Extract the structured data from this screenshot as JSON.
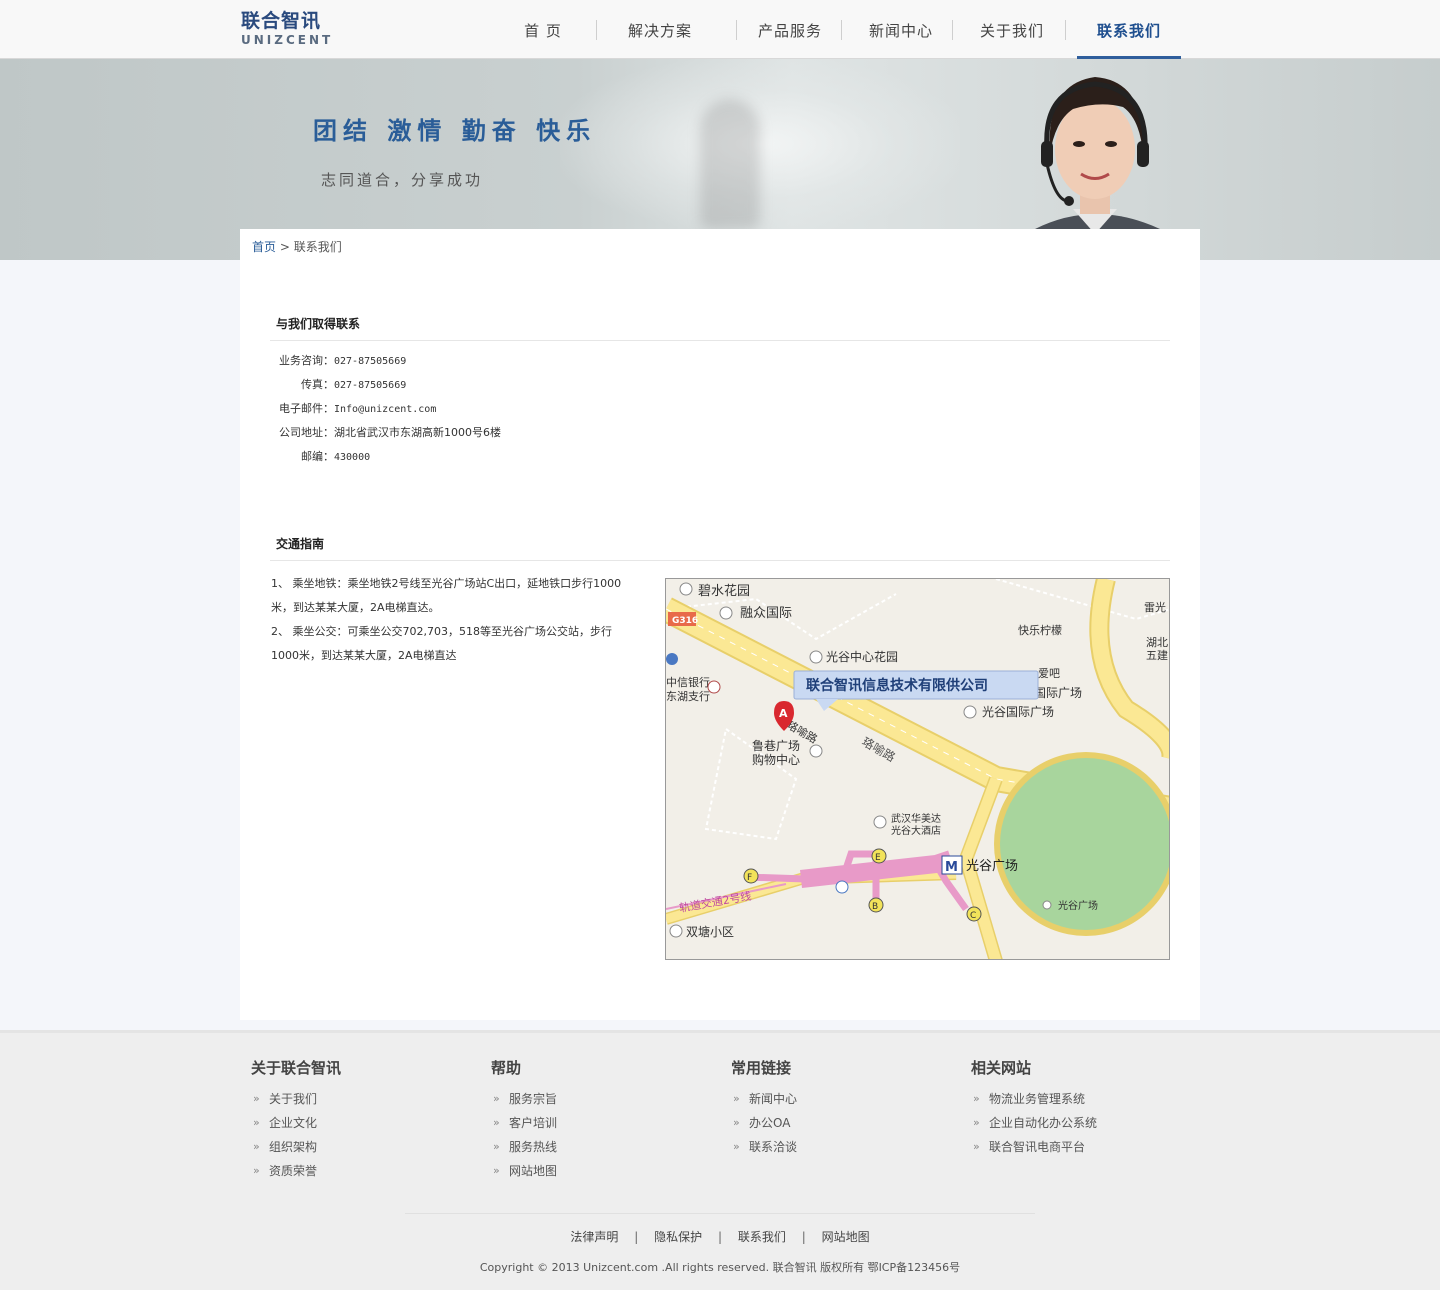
{
  "header": {
    "logo_cn": "联合智讯",
    "logo_en": "UNIZCENT",
    "nav": [
      {
        "label": "首 页"
      },
      {
        "label": "解决方案"
      },
      {
        "label": "产品服务"
      },
      {
        "label": "新闻中心"
      },
      {
        "label": "关于我们"
      },
      {
        "label": "联系我们"
      }
    ],
    "active_color": "#1f4f8f"
  },
  "banner": {
    "slogan": "团结 激情 勤奋 快乐",
    "subslogan": "志同道合，分享成功"
  },
  "breadcrumb": {
    "home": "首页",
    "separator": ">",
    "current": "联系我们"
  },
  "contact": {
    "title": "与我们取得联系",
    "rows": [
      {
        "label": "业务咨询：",
        "value": "027-87505669"
      },
      {
        "label": "传真：",
        "value": "027-87505669"
      },
      {
        "label": "电子邮件：",
        "value": "Info@unizcent.com"
      },
      {
        "label": "公司地址：",
        "value": "湖北省武汉市东湖高新1000号6楼"
      },
      {
        "label": "邮编：",
        "value": "430000"
      }
    ]
  },
  "transport": {
    "title": "交通指南",
    "lines": [
      "1、 乘坐地铁：乘坐地铁2号线至光谷广场站C出口，延地铁口步行1000米，到达某某大厦，2A电梯直达。",
      "2、 乘坐公交：可乘坐公交702,703，518等至光谷广场公交站，步行1000米，到达某某大厦，2A电梯直达"
    ]
  },
  "map": {
    "callout": "联合智讯信息技术有限供公司",
    "marker": "A",
    "labels": {
      "bishui": "碧水花园",
      "rongzhong": "融众国际",
      "leiguang": "雷光",
      "g316": "G316",
      "kuaile": "快乐柠檬",
      "hubei": "湖北",
      "wujian": "五建",
      "guanggu_garden": "光谷中心花园",
      "aiba": "爱吧",
      "zhongxin1": "中信银行",
      "zhongxin2": "东湖支行",
      "intl1": "国际广场",
      "intl2": "光谷国际广场",
      "road1": "珞喻路",
      "road2": "珞喻路",
      "luxiang1": "鲁巷广场",
      "luxiang2": "购物中心",
      "hotel1": "武汉华美达",
      "hotel2": "光谷大酒店",
      "station": "光谷广场",
      "square": "光谷广场",
      "metro": "轨道交通2号线",
      "shuangtang": "双塘小区",
      "exit_e": "E",
      "exit_f": "F",
      "exit_b": "B",
      "exit_c": "C",
      "metro_logo": "M"
    }
  },
  "footer": {
    "columns": [
      {
        "title": "关于联合智讯",
        "items": [
          "关于我们",
          "企业文化",
          "组织架构",
          "资质荣誉"
        ]
      },
      {
        "title": "帮助",
        "items": [
          "服务宗旨",
          "客户培训",
          "服务热线",
          "网站地图"
        ]
      },
      {
        "title": "常用链接",
        "items": [
          "新闻中心",
          "办公OA",
          "联系洽谈"
        ]
      },
      {
        "title": "相关网站",
        "items": [
          "物流业务管理系统",
          "企业自动化办公系统",
          "联合智讯电商平台"
        ]
      }
    ],
    "links": [
      "法律声明",
      "隐私保护",
      "联系我们",
      "网站地图"
    ],
    "link_separator": "|",
    "copyright": "Copyright © 2013  Unizcent.com .All rights reserved. 联合智讯 版权所有  鄂ICP备123456号"
  }
}
